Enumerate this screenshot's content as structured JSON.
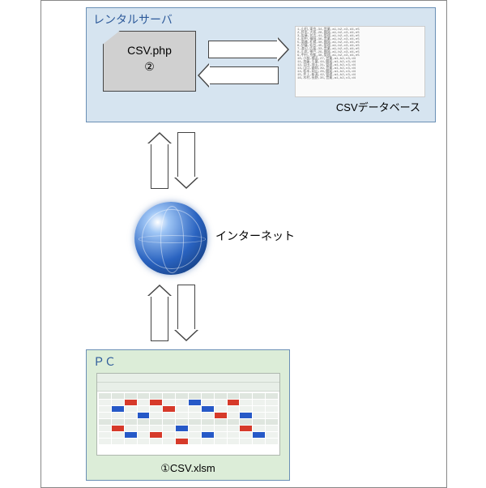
{
  "zones": {
    "server": {
      "title": "レンタルサーバ"
    },
    "pc": {
      "title": "ＰＣ"
    }
  },
  "nodes": {
    "php_file": {
      "line1": "CSV.php",
      "line2": "②"
    },
    "csv_db": {
      "label": "CSVデータベース"
    },
    "internet": {
      "label": "インターネット"
    },
    "excel_file": {
      "label": "①CSV.xlsm"
    }
  }
}
